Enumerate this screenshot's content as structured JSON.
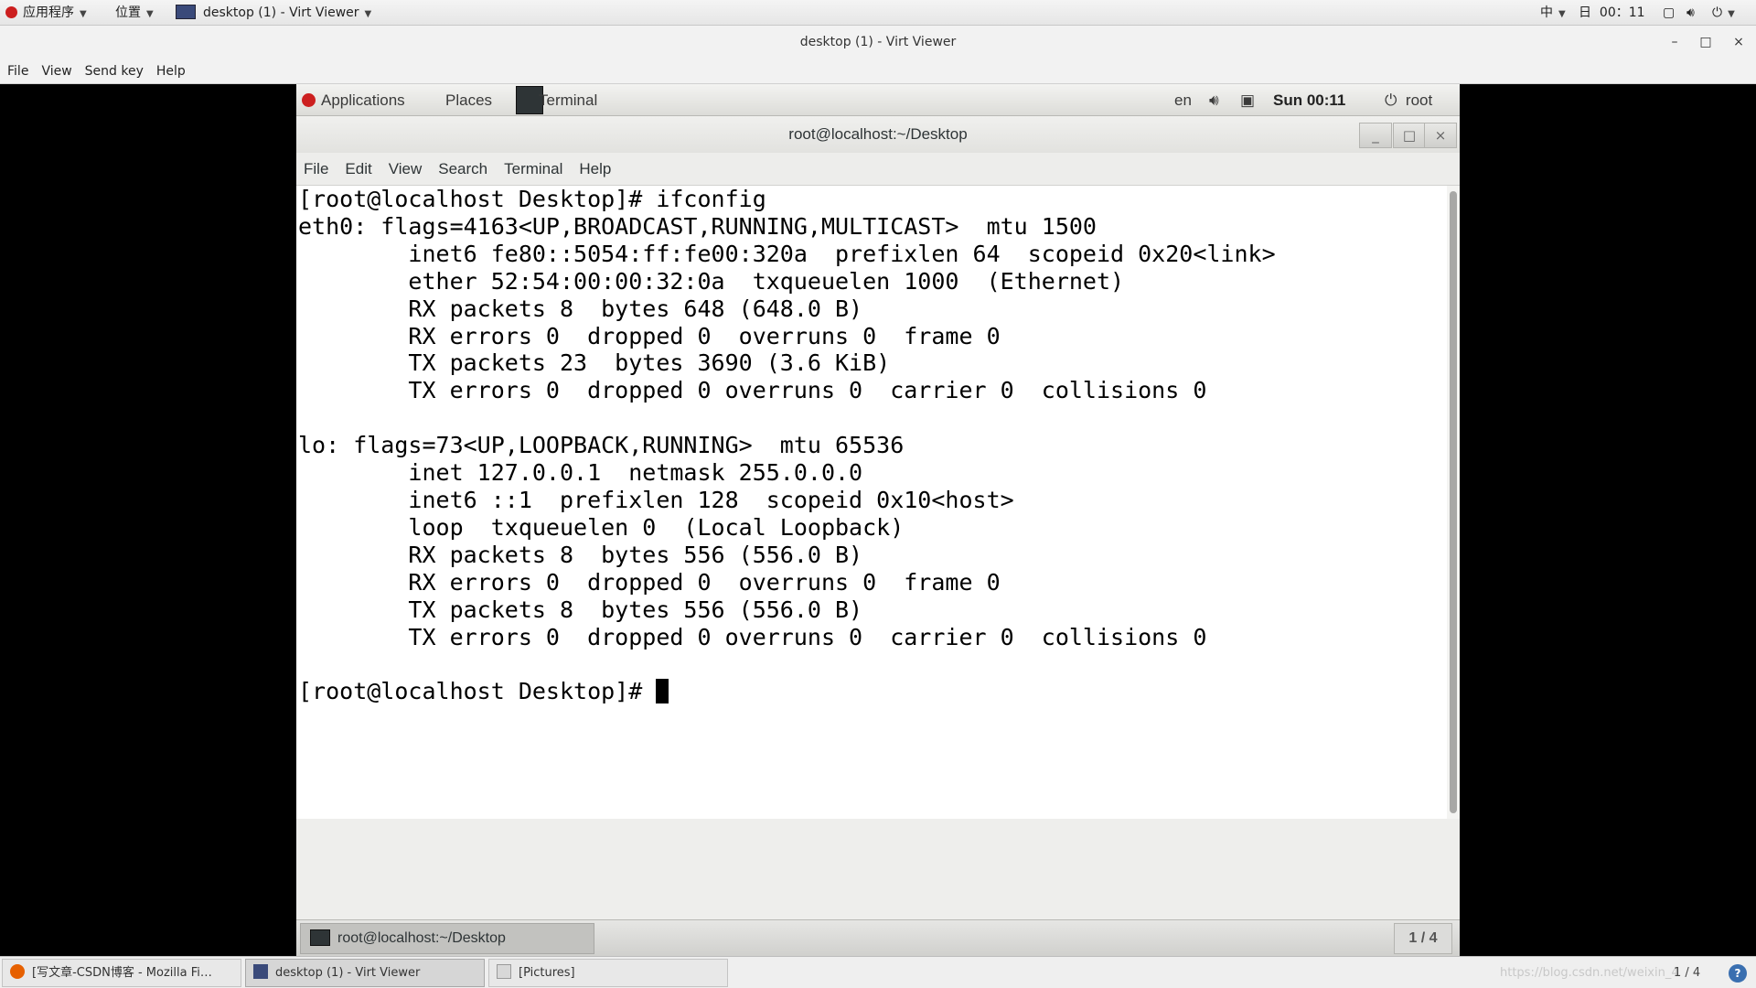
{
  "host_topbar": {
    "apps_menu": "应用程序",
    "places_menu": "位置",
    "window_menu": "desktop (1) - Virt Viewer",
    "input_method": "中",
    "day": "日",
    "clock": "00：11"
  },
  "virt_viewer": {
    "title": "desktop (1) - Virt Viewer",
    "minimize": "–",
    "maximize": "□",
    "close": "×",
    "menu": [
      "File",
      "View",
      "Send key",
      "Help"
    ]
  },
  "guest_topbar": {
    "applications": "Applications",
    "places": "Places",
    "terminal": "Terminal",
    "lang": "en",
    "clock": "Sun 00:11",
    "user": "root"
  },
  "terminal_window": {
    "title": "root@localhost:~/Desktop",
    "minimize": "_",
    "maximize": "□",
    "close": "×",
    "menu": [
      "File",
      "Edit",
      "View",
      "Search",
      "Terminal",
      "Help"
    ],
    "lines": [
      "[root@localhost Desktop]# ifconfig",
      "eth0: flags=4163<UP,BROADCAST,RUNNING,MULTICAST>  mtu 1500",
      "        inet6 fe80::5054:ff:fe00:320a  prefixlen 64  scopeid 0x20<link>",
      "        ether 52:54:00:00:32:0a  txqueuelen 1000  (Ethernet)",
      "        RX packets 8  bytes 648 (648.0 B)",
      "        RX errors 0  dropped 0  overruns 0  frame 0",
      "        TX packets 23  bytes 3690 (3.6 KiB)",
      "        TX errors 0  dropped 0 overruns 0  carrier 0  collisions 0",
      "",
      "lo: flags=73<UP,LOOPBACK,RUNNING>  mtu 65536",
      "        inet 127.0.0.1  netmask 255.0.0.0",
      "        inet6 ::1  prefixlen 128  scopeid 0x10<host>",
      "        loop  txqueuelen 0  (Local Loopback)",
      "        RX packets 8  bytes 556 (556.0 B)",
      "        RX errors 0  dropped 0  overruns 0  frame 0",
      "        TX packets 8  bytes 556 (556.0 B)",
      "        TX errors 0  dropped 0 overruns 0  carrier 0  collisions 0",
      ""
    ],
    "prompt": "[root@localhost Desktop]# "
  },
  "guest_bottombar": {
    "task": "root@localhost:~/Desktop",
    "workspace": "1 / 4"
  },
  "host_taskbar": {
    "items": [
      "[写文章-CSDN博客 - Mozilla Fi…",
      "desktop (1) - Virt Viewer",
      "[Pictures]"
    ],
    "watermark": "https://blog.csdn.net/weixin_4",
    "pager": "1 / 4"
  },
  "colors": {
    "terminal_bg": "#ffffff",
    "terminal_fg": "#000000",
    "redhat": "#cc1f1f"
  }
}
